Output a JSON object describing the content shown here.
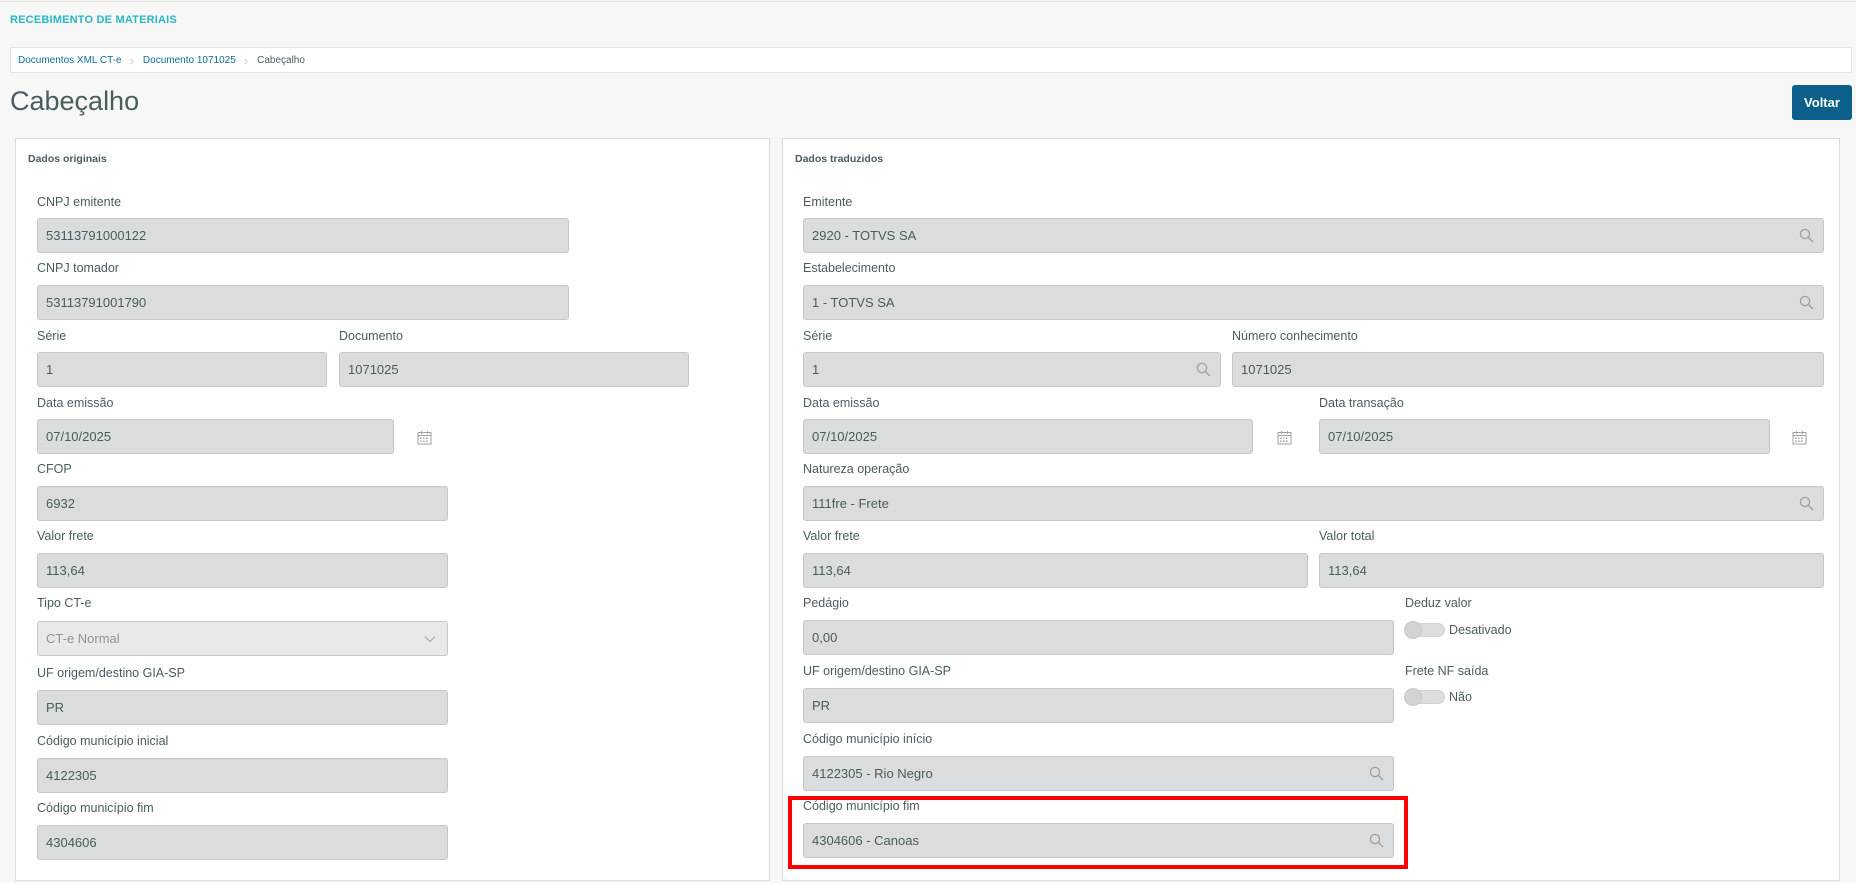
{
  "app": {
    "title": "RECEBIMENTO DE MATERIAIS"
  },
  "breadcrumb": [
    "Documentos XML CT-e",
    "Documento 1071025",
    "Cabeçalho"
  ],
  "page": {
    "title": "Cabeçalho",
    "back_label": "Voltar"
  },
  "original": {
    "title": "Dados originais",
    "cnpj_emitente": {
      "label": "CNPJ emitente",
      "value": "53113791000122"
    },
    "cnpj_tomador": {
      "label": "CNPJ tomador",
      "value": "53113791001790"
    },
    "serie": {
      "label": "Série",
      "value": "1"
    },
    "documento": {
      "label": "Documento",
      "value": "1071025"
    },
    "data_emissao": {
      "label": "Data emissão",
      "value": "07/10/2025"
    },
    "cfop": {
      "label": "CFOP",
      "value": "6932"
    },
    "valor_frete": {
      "label": "Valor frete",
      "value": "113,64"
    },
    "tipo_cte": {
      "label": "Tipo CT-e",
      "value": "CT-e Normal"
    },
    "uf": {
      "label": "UF origem/destino GIA-SP",
      "value": "PR"
    },
    "mun_inicial": {
      "label": "Código município inicial",
      "value": "4122305"
    },
    "mun_fim": {
      "label": "Código município fim",
      "value": "4304606"
    }
  },
  "translated": {
    "title": "Dados traduzidos",
    "emitente": {
      "label": "Emitente",
      "value": "2920 - TOTVS SA"
    },
    "estabelecimento": {
      "label": "Estabelecimento",
      "value": "1 - TOTVS SA"
    },
    "serie": {
      "label": "Série",
      "value": "1"
    },
    "numero": {
      "label": "Número conhecimento",
      "value": "1071025"
    },
    "data_emissao": {
      "label": "Data emissão",
      "value": "07/10/2025"
    },
    "data_transacao": {
      "label": "Data transação",
      "value": "07/10/2025"
    },
    "natureza": {
      "label": "Natureza operação",
      "value": "111fre - Frete"
    },
    "valor_frete": {
      "label": "Valor frete",
      "value": "113,64"
    },
    "valor_total": {
      "label": "Valor total",
      "value": "113,64"
    },
    "pedagio": {
      "label": "Pedágio",
      "value": "0,00"
    },
    "deduz": {
      "label": "Deduz valor",
      "state": "Desativado",
      "on": false
    },
    "uf": {
      "label": "UF origem/destino GIA-SP",
      "value": "PR"
    },
    "frete_nf": {
      "label": "Frete NF saída",
      "state": "Não",
      "on": false
    },
    "mun_inicio": {
      "label": "Código município início",
      "value": "4122305 - Rio Negro"
    },
    "mun_fim": {
      "label": "Código município fim",
      "value": "4304606 - Canoas"
    }
  },
  "colors": {
    "accent": "#29b6c5",
    "primary_button": "#0c5f8a",
    "highlight": "#ff0000",
    "field_bg": "#dadcdd"
  }
}
